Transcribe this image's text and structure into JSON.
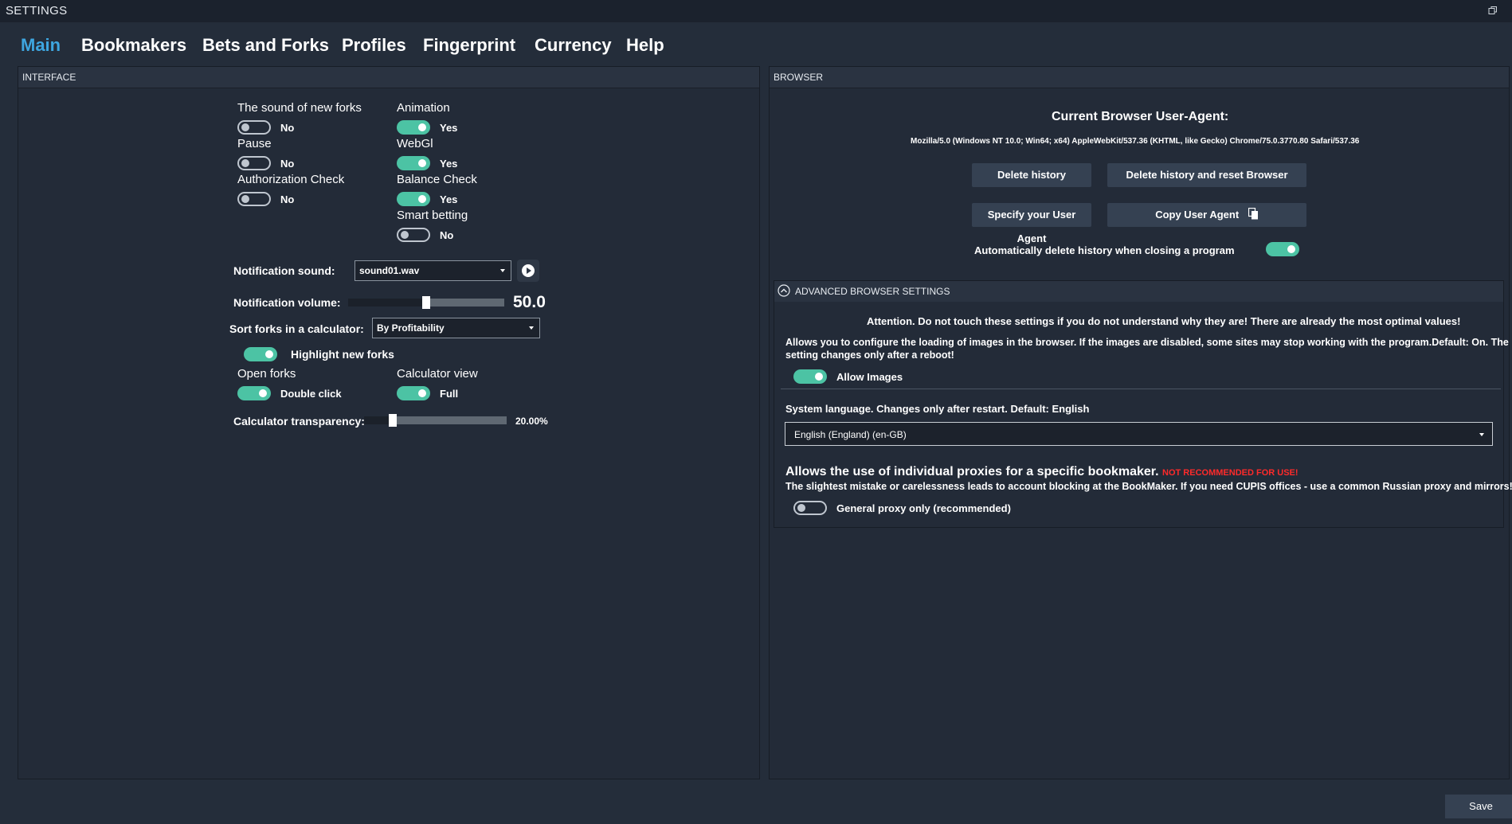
{
  "window": {
    "title": "SETTINGS"
  },
  "tabs": [
    "Main",
    "Bookmakers",
    "Bets and Forks",
    "Profiles",
    "Fingerprint",
    "Currency",
    "Help"
  ],
  "interface": {
    "header": "INTERFACE",
    "sound_new_forks": {
      "label": "The sound of new forks",
      "on": false,
      "value": "No"
    },
    "animation": {
      "label": "Animation",
      "on": true,
      "value": "Yes"
    },
    "pause": {
      "label": "Pause",
      "on": false,
      "value": "No"
    },
    "webgl": {
      "label": "WebGl",
      "on": true,
      "value": "Yes"
    },
    "auth_check": {
      "label": "Authorization Check",
      "on": false,
      "value": "No"
    },
    "balance_check": {
      "label": "Balance Check",
      "on": true,
      "value": "Yes"
    },
    "smart_betting": {
      "label": "Smart betting",
      "on": false,
      "value": "No"
    },
    "notification_sound": {
      "label": "Notification sound:",
      "value": "sound01.wav"
    },
    "notification_volume": {
      "label": "Notification volume:",
      "value": "50.0",
      "fraction": 0.5
    },
    "sort_forks": {
      "label": "Sort forks in a calculator:",
      "value": "By Profitability"
    },
    "highlight_new_forks": {
      "label": "Highlight new forks",
      "on": true
    },
    "open_forks": {
      "label": "Open forks",
      "on": true,
      "value": "Double click"
    },
    "calculator_view": {
      "label": "Calculator view",
      "on": true,
      "value": "Full"
    },
    "calculator_transparency": {
      "label": "Calculator transparency:",
      "value": "20.00%",
      "fraction": 0.2
    }
  },
  "browser": {
    "header": "BROWSER",
    "ua_title": "Current Browser User-Agent:",
    "ua_string": "Mozilla/5.0 (Windows NT 10.0; Win64; x64) AppleWebKit/537.36 (KHTML, like Gecko) Chrome/75.0.3770.80 Safari/537.36",
    "delete_history": "Delete history",
    "delete_reset": "Delete history and reset Browser",
    "specify_ua": "Specify your User Agent",
    "copy_ua": "Copy User Agent",
    "auto_delete": {
      "label": "Automatically delete history when closing a program",
      "on": true
    },
    "advanced": {
      "header": "ADVANCED BROWSER SETTINGS",
      "attention": "Attention. Do not touch these settings if you do not understand why they are! There are already the most optimal values!",
      "images_desc_1": "Allows you to configure the loading of images in the browser. If the images are disabled, some sites may stop working with the program.Default: On. The",
      "images_desc_2": "setting changes only after a reboot!",
      "allow_images": {
        "label": "Allow Images",
        "on": true
      },
      "language_desc": "System language. Changes only after restart. Default: English",
      "language_value": "English (England) (en-GB)",
      "proxy_title": "Allows the use of individual proxies for a specific bookmaker.",
      "proxy_warning": "NOT RECOMMENDED FOR USE!",
      "proxy_desc": "The slightest mistake or carelessness leads to account blocking at the BookMaker. If you need CUPIS offices - use a common Russian proxy and mirrors!",
      "general_proxy": {
        "label": "General proxy only (recommended)",
        "on": false
      }
    }
  },
  "footer": {
    "save": "Save"
  },
  "colors": {
    "accent": "#3ea6e0",
    "toggle_on": "#4cc3a4",
    "warning": "#ff2a2a"
  }
}
